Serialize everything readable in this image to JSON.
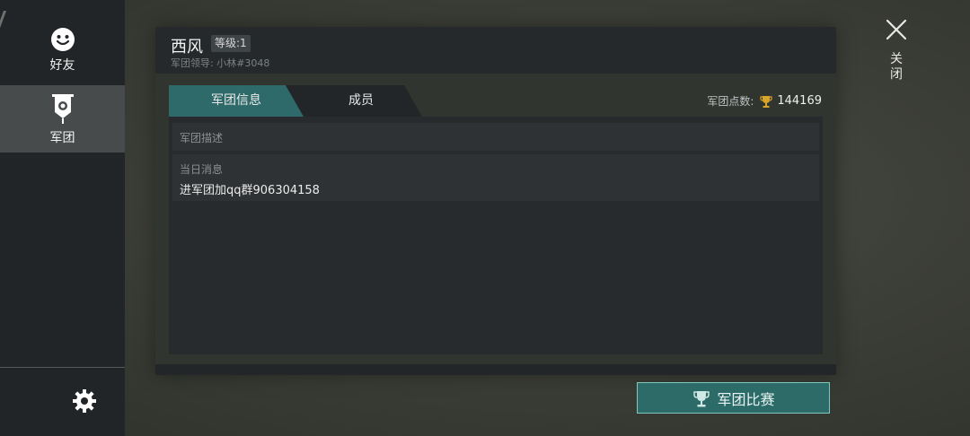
{
  "sidebar": {
    "items": [
      {
        "label": "好友",
        "icon": "smiley-icon"
      },
      {
        "label": "军团",
        "icon": "legion-banner-icon"
      }
    ],
    "settings_icon": "gear-icon"
  },
  "header": {
    "legion_name": "西风",
    "level_text": "等级:1",
    "leader_text": "军团领导: 小林#3048"
  },
  "tabs": [
    {
      "label": "军团信息",
      "active": true
    },
    {
      "label": "成员",
      "active": false
    }
  ],
  "points": {
    "label": "军团点数:",
    "value": "144169"
  },
  "info": {
    "description_label": "军团描述",
    "daily_message_label": "当日消息",
    "daily_message": "进军团加qq群906304158"
  },
  "close": {
    "label": "关闭"
  },
  "tournament_button": {
    "label": "军团比赛"
  },
  "colors": {
    "accent_teal": "#2f6a6a",
    "trophy_gold": "#d8a527",
    "sidebar_bg": "#212527"
  }
}
